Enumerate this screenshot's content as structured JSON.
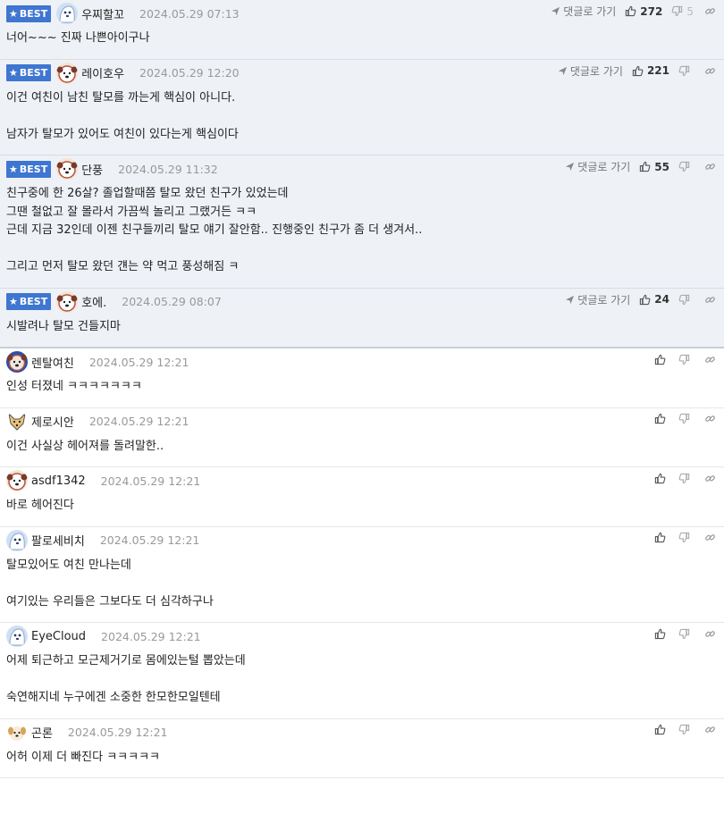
{
  "best_label": "BEST",
  "reply_link_label": "댓글로 가기",
  "comments": [
    {
      "nick": "우찌할꼬",
      "date": "2024.05.29 07:13",
      "best": true,
      "up": "272",
      "down": "5",
      "avatar": "blue",
      "lines": [
        "너어~~~ 진짜 나쁜아이구나"
      ]
    },
    {
      "nick": "레이호우",
      "date": "2024.05.29 12:20",
      "best": true,
      "up": "221",
      "down": "",
      "avatar": "dog",
      "lines": [
        "이건 여친이 남친 탈모를 까는게 핵심이 아니다.",
        "",
        "남자가 탈모가 있어도 여친이 있다는게 핵심이다"
      ]
    },
    {
      "nick": "단풍",
      "date": "2024.05.29 11:32",
      "best": true,
      "up": "55",
      "down": "",
      "avatar": "dog",
      "lines": [
        "친구중에 한 26살? 졸업할때쯤 탈모 왔던 친구가 있었는데",
        "그땐 철없고 잘 몰라서 가끔씩 놀리고 그랬거든 ㅋㅋ",
        "근데 지금 32인데 이젠 친구들끼리 탈모 얘기 잘안함.. 진행중인 친구가 좀 더 생겨서..",
        "",
        "그리고 먼저 탈모 왔던 걘는 약 먹고 풍성해짐 ㅋ"
      ]
    },
    {
      "nick": "호에.",
      "date": "2024.05.29 08:07",
      "best": true,
      "up": "24",
      "down": "",
      "avatar": "dog",
      "lines": [
        "시발려나 탈모 건들지마"
      ]
    },
    {
      "nick": "렌탈여친",
      "date": "2024.05.29 12:21",
      "best": false,
      "up": "",
      "down": "",
      "avatar": "blue-dog",
      "lines": [
        "인성 터졌네 ㅋㅋㅋㅋㅋㅋㅋ"
      ]
    },
    {
      "nick": "제로시안",
      "date": "2024.05.29 12:21",
      "best": false,
      "up": "",
      "down": "",
      "avatar": "fox",
      "lines": [
        "이건 사실상 헤어져를 돌려말한.."
      ]
    },
    {
      "nick": "asdf1342",
      "date": "2024.05.29 12:21",
      "best": false,
      "up": "",
      "down": "",
      "avatar": "dog",
      "lines": [
        "바로 헤어진다"
      ]
    },
    {
      "nick": "팔로세비치",
      "date": "2024.05.29 12:21",
      "best": false,
      "up": "",
      "down": "",
      "avatar": "blue",
      "lines": [
        "탈모있어도 여친 만나는데",
        "",
        "여기있는 우리들은 그보다도 더 심각하구나"
      ]
    },
    {
      "nick": "EyeCloud",
      "date": "2024.05.29 12:21",
      "best": false,
      "up": "",
      "down": "",
      "avatar": "blue",
      "lines": [
        "어제 퇴근하고 모근제거기로 몸에있는털 뽑았는데",
        "",
        "숙연해지네 누구에겐 소중한 한모한모일텐테"
      ]
    },
    {
      "nick": "곤론",
      "date": "2024.05.29 12:21",
      "best": false,
      "up": "",
      "down": "",
      "avatar": "pup",
      "lines": [
        "어허 이제 더 빠진다 ㅋㅋㅋㅋㅋ"
      ]
    }
  ]
}
